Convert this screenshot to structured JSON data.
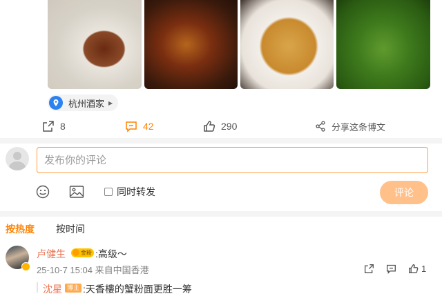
{
  "location": {
    "name": "杭州酒家"
  },
  "actions": {
    "forward_count": "8",
    "comment_count": "42",
    "like_count": "290",
    "share_label": "分享这条博文"
  },
  "composer": {
    "placeholder": "发布你的评论",
    "sync_forward_label": "同时转发",
    "submit_label": "评论",
    "emoji_icon": "emoji-icon",
    "image_icon": "image-icon"
  },
  "sort": {
    "hot_label": "按热度",
    "time_label": "按时间"
  },
  "comment": {
    "author": "卢健生",
    "author_badge": "金粉",
    "text": ":高级～",
    "meta": "25-10-7 15:04 来自中国香港",
    "like_count": "1"
  },
  "reply": {
    "author": "沈星",
    "author_badge": "博主",
    "text": ":天香樓的蟹粉面更胜一筹"
  },
  "colors": {
    "accent": "#ff8200",
    "name": "#eb7350",
    "location_pin": "#2b82f0",
    "submit_disabled": "#ffc08a"
  }
}
